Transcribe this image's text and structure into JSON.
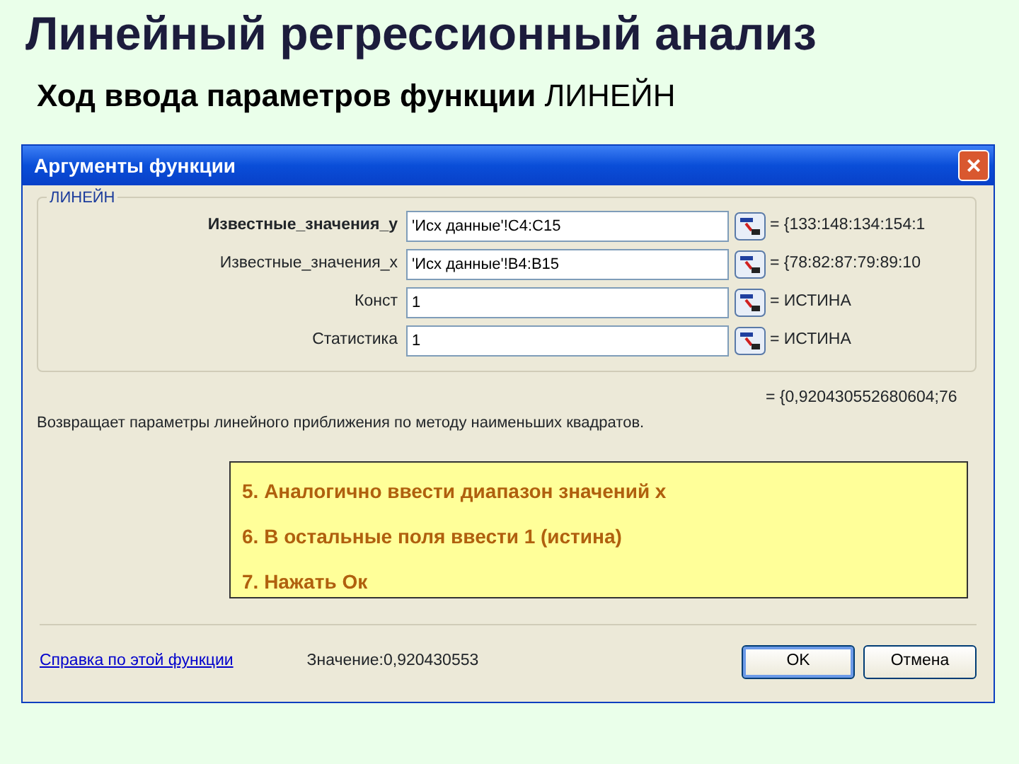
{
  "slide": {
    "title": "Линейный регрессионный анализ",
    "subtitle": "**Ход ввода параметров функции** ЛИНЕЙН"
  },
  "dialog": {
    "title": "Аргументы функции",
    "close": "×",
    "group": "ЛИНЕЙН",
    "arguments": [
      {
        "label": "Известные_значения_y",
        "value": "'Исх данные'!C4:C15",
        "result": "= {133:148:134:154:1",
        "active": true
      },
      {
        "label": "Известные_значения_x",
        "value": "'Исх данные'!B4:B15",
        "result": "= {78:82:87:79:89:10",
        "active": false
      },
      {
        "label": "Конст",
        "value": "1",
        "result": "= ИСТИНА",
        "active": false
      },
      {
        "label": "Статистика",
        "value": "1",
        "result": "= ИСТИНА",
        "active": false
      }
    ],
    "formula_result": "= {0,920430552680604;76",
    "description": "Возвращает параметры линейного приближения по методу наименьших квадратов.",
    "note": [
      "5. Аналогично ввести диапазон значений x",
      "6. В остальные поля ввести 1 (истина)",
      "7. Нажать Ок"
    ],
    "help_link": "Справка по этой функции",
    "value_text": "Значение:0,920430553",
    "buttons": [
      {
        "label": "OK",
        "default": true
      },
      {
        "label": "Отмена",
        "default": false
      }
    ]
  }
}
